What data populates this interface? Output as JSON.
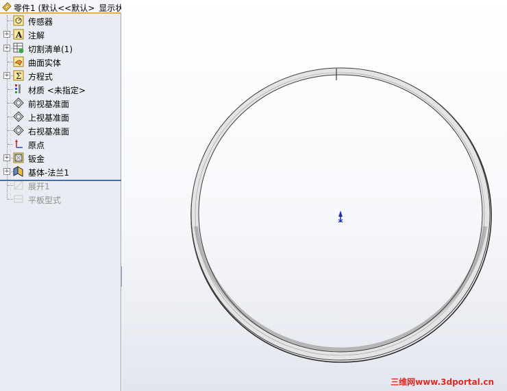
{
  "tree": {
    "root_label": "零件1  (默认<<默认>_显示状",
    "items": [
      {
        "label": "传感器",
        "icon": "sensor-icon",
        "expandable": false,
        "enabled": true
      },
      {
        "label": "注解",
        "icon": "annotation-icon",
        "expandable": true,
        "enabled": true
      },
      {
        "label": "切割清单(1)",
        "icon": "cut-list-icon",
        "expandable": true,
        "enabled": true
      },
      {
        "label": "曲面实体",
        "icon": "surface-bodies-icon",
        "expandable": false,
        "enabled": true
      },
      {
        "label": "方程式",
        "icon": "equations-icon",
        "expandable": true,
        "enabled": true
      },
      {
        "label": "材质 <未指定>",
        "icon": "material-icon",
        "expandable": false,
        "enabled": true
      },
      {
        "label": "前视基准面",
        "icon": "plane-icon",
        "expandable": false,
        "enabled": true
      },
      {
        "label": "上视基准面",
        "icon": "plane-icon",
        "expandable": false,
        "enabled": true
      },
      {
        "label": "右视基准面",
        "icon": "plane-icon",
        "expandable": false,
        "enabled": true
      },
      {
        "label": "原点",
        "icon": "origin-icon",
        "expandable": false,
        "enabled": true
      },
      {
        "label": "钣金",
        "icon": "sheet-metal-icon",
        "expandable": true,
        "enabled": true
      },
      {
        "label": "基体-法兰1",
        "icon": "base-flange-icon",
        "expandable": true,
        "enabled": true
      },
      {
        "label": "展开1",
        "icon": "unfold-icon",
        "expandable": false,
        "enabled": false
      },
      {
        "label": "平板型式",
        "icon": "flat-pattern-icon",
        "expandable": false,
        "enabled": false
      }
    ]
  },
  "watermark": "三维网www.3dportal.cn",
  "colors": {
    "panel_bg": "#e9edf3",
    "header_accent": "#e8b23a",
    "rollback_bar": "#3e6fb0",
    "watermark": "#e0291f",
    "origin_marker": "#1d2fb0"
  }
}
